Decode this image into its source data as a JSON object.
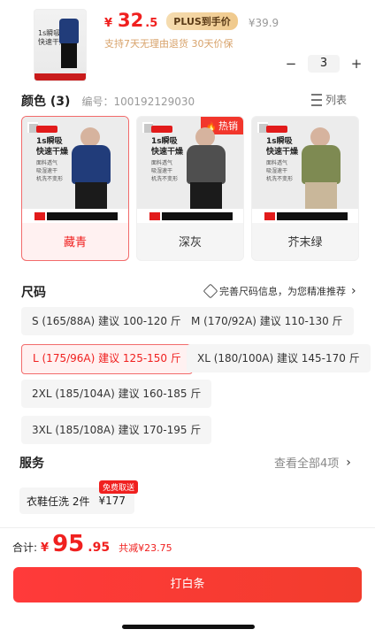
{
  "product": {
    "price_symbol": "¥",
    "price_int": "32",
    "price_dec": ".5",
    "plus_label": "PLUS到手价",
    "original_price": "¥39.9",
    "returns": "支持7天无理由退货  30天价保",
    "quantity": "3",
    "thumb_text": "1s瞬吸\n快速干燥"
  },
  "color_section": {
    "title": "颜色 (3)",
    "code": "编号：100192129030",
    "list_label": "列表",
    "hot_label": "热销",
    "img_headline": "1s瞬吸\n快速干燥",
    "img_sub": "面料透气\n吸湿速干\n机洗不变形",
    "cards": [
      {
        "label": "藏青",
        "shirt_color": "#213c7a"
      },
      {
        "label": "深灰",
        "shirt_color": "#4f4f4f"
      },
      {
        "label": "芥末绿",
        "shirt_color": "#7e8a52"
      }
    ]
  },
  "size_section": {
    "title": "尺码",
    "hint": "完善尺码信息，为您精准推荐",
    "options": [
      "S (165/88A) 建议 100-120 斤",
      "M (170/92A) 建议 110-130 斤",
      "L (175/96A) 建议 125-150 斤",
      "XL (180/100A) 建议 145-170 斤",
      "2XL (185/104A) 建议 160-185 斤",
      "3XL (185/108A) 建议 170-195 斤"
    ]
  },
  "service_section": {
    "title": "服务",
    "more": "查看全部4项",
    "item_label": "衣鞋任洗 2件",
    "item_price": "¥177",
    "item_tag": "免费取送"
  },
  "footer": {
    "total_label": "合计:",
    "total_symbol": "¥",
    "total_int": "95",
    "total_dec": ".95",
    "saving": "共减¥23.75",
    "cta": "打白条"
  },
  "colors": {
    "accent": "#f0201f",
    "gold": "#d8a36b"
  }
}
